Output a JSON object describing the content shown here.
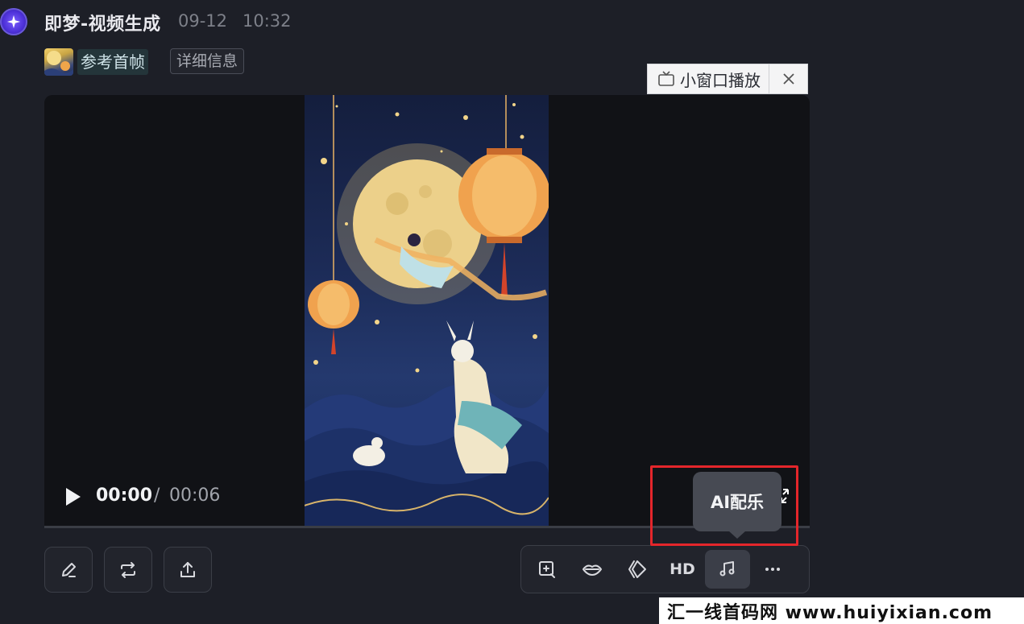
{
  "message": {
    "app_name": "即梦-视频生成",
    "date": "09-12",
    "time": "10:32"
  },
  "reference": {
    "label": "参考首帧",
    "detail_button": "详细信息"
  },
  "mini_player": {
    "label": "小窗口播放"
  },
  "player": {
    "current_time": "00:00",
    "separator": "/",
    "total_time": "00:06",
    "progress_fraction": 0.0
  },
  "tooltip": {
    "text": "AI配乐"
  },
  "toolbar": {
    "hd_label": "HD"
  },
  "watermark": {
    "text": "汇一线首码网 www.huiyixian.com"
  },
  "colors": {
    "background": "#1d1f27",
    "highlight": "#e4262b",
    "tooltip": "#474a53"
  }
}
